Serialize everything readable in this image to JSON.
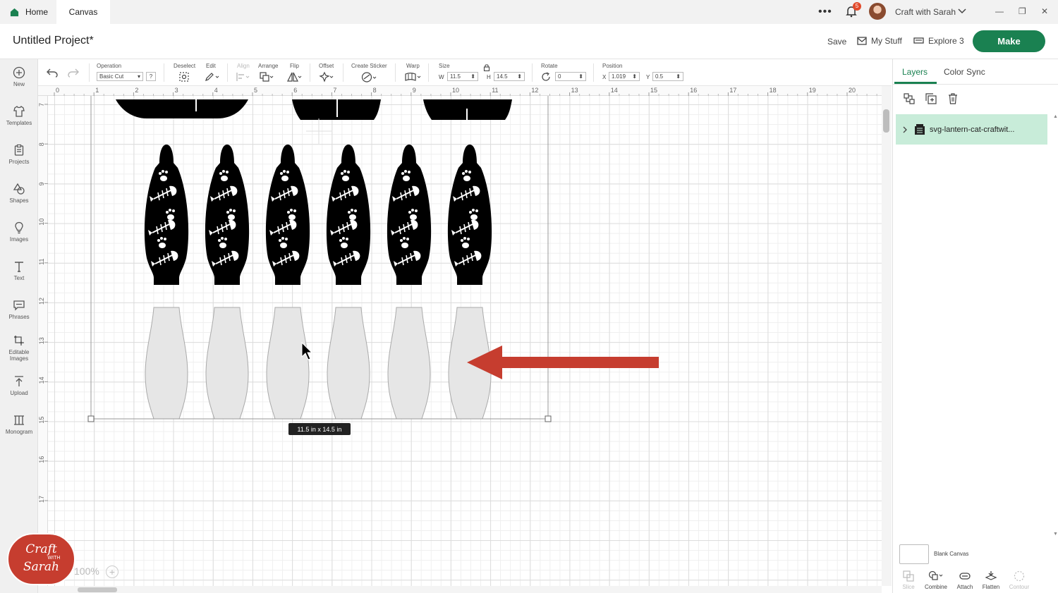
{
  "tabs": {
    "home": "Home",
    "canvas": "Canvas"
  },
  "account": {
    "name": "Craft with Sarah",
    "notifications": "5"
  },
  "header": {
    "project_title": "Untitled Project*",
    "save": "Save",
    "my_stuff": "My Stuff",
    "machine": "Explore 3",
    "make": "Make"
  },
  "sidebar": {
    "items": [
      {
        "label": "New",
        "icon": "plus-circle-icon"
      },
      {
        "label": "Templates",
        "icon": "shirt-icon"
      },
      {
        "label": "Projects",
        "icon": "clipboard-icon"
      },
      {
        "label": "Shapes",
        "icon": "shapes-icon"
      },
      {
        "label": "Images",
        "icon": "lightbulb-icon"
      },
      {
        "label": "Text",
        "icon": "text-icon"
      },
      {
        "label": "Phrases",
        "icon": "speech-bubble-icon"
      },
      {
        "label": "Editable Images",
        "icon": "editable-images-icon"
      },
      {
        "label": "Upload",
        "icon": "upload-icon"
      },
      {
        "label": "Monogram",
        "icon": "monogram-icon"
      }
    ]
  },
  "toolbar": {
    "operation_label": "Operation",
    "operation_value": "Basic Cut",
    "help": "?",
    "deselect": "Deselect",
    "edit": "Edit",
    "align": "Align",
    "arrange": "Arrange",
    "flip": "Flip",
    "offset": "Offset",
    "create_sticker": "Create Sticker",
    "warp": "Warp",
    "size_label": "Size",
    "w_label": "W",
    "w_value": "11.5",
    "h_label": "H",
    "h_value": "14.5",
    "rotate_label": "Rotate",
    "rotate_value": "0",
    "position_label": "Position",
    "x_label": "X",
    "x_value": "1.019",
    "y_label": "Y",
    "y_value": "0.5"
  },
  "rulers": {
    "top": [
      "0",
      "1",
      "2",
      "3",
      "4",
      "5",
      "6",
      "7",
      "8",
      "9",
      "10",
      "11",
      "12",
      "13",
      "14",
      "15",
      "16",
      "17",
      "18",
      "19",
      "20"
    ],
    "left": [
      "7",
      "8",
      "9",
      "10",
      "11",
      "12",
      "13",
      "14",
      "15",
      "16",
      "17"
    ]
  },
  "canvas": {
    "size_tooltip": "11.5  in x 14.5  in",
    "zoom": "100%",
    "zoom_plus": "+",
    "lantern_count": 6
  },
  "logo": {
    "line1": "Craft",
    "with": "WITH",
    "line2": "Sarah"
  },
  "right_panel": {
    "tab_layers": "Layers",
    "tab_color_sync": "Color Sync",
    "layer_name": "svg-lantern-cat-craftwit...",
    "blank_canvas": "Blank Canvas",
    "bottom_tools": [
      "Slice",
      "Combine",
      "Attach",
      "Flatten",
      "Contour"
    ]
  },
  "colors": {
    "accent": "#1a8151",
    "arrow": "#c63d2f",
    "layer_highlight": "#c8ecd9"
  }
}
